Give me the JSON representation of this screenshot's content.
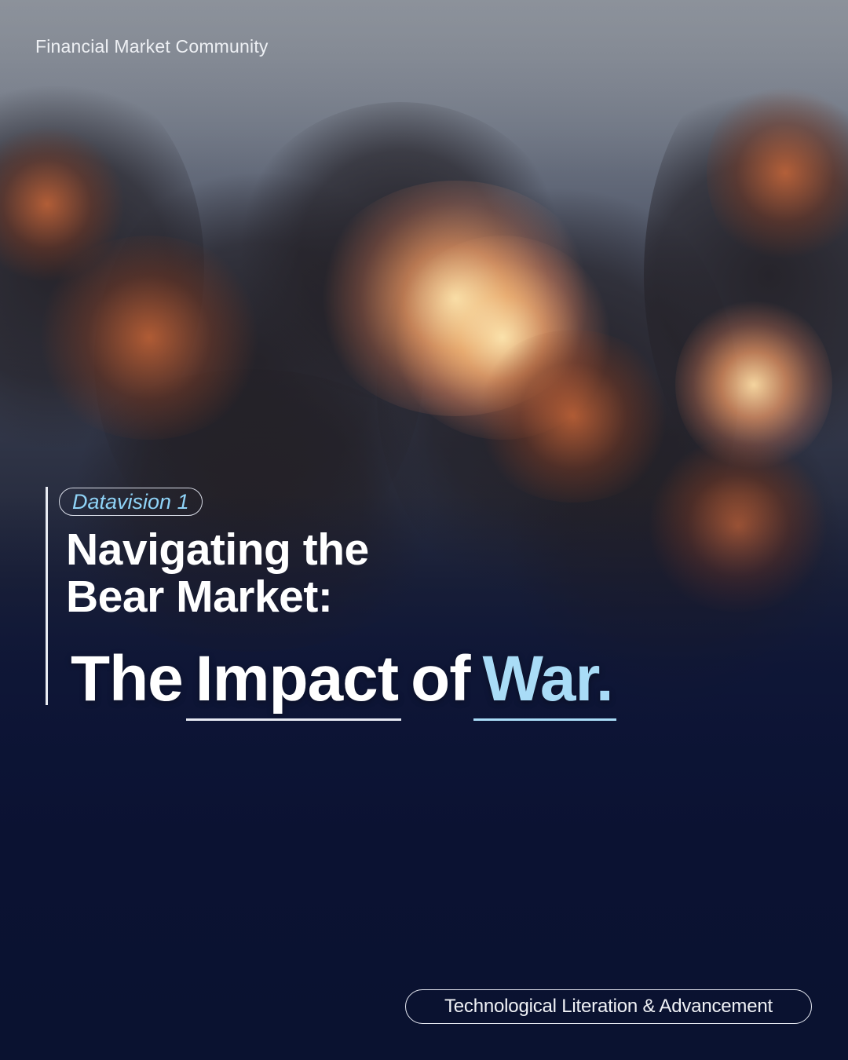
{
  "brand": {
    "name": "Financial Market Community"
  },
  "badge": {
    "label": "Datavision 1"
  },
  "headline": {
    "line1": "Navigating the",
    "line2": "Bear Market:"
  },
  "subheadline": {
    "word1": "The",
    "word2": "Impact",
    "word3": "of",
    "word4": "War."
  },
  "tagline": {
    "label": "Technological Literation & Advancement"
  },
  "colors": {
    "accent": "#a9dcf7",
    "badge_text": "#8fd3f7",
    "background": "#0a1230"
  }
}
